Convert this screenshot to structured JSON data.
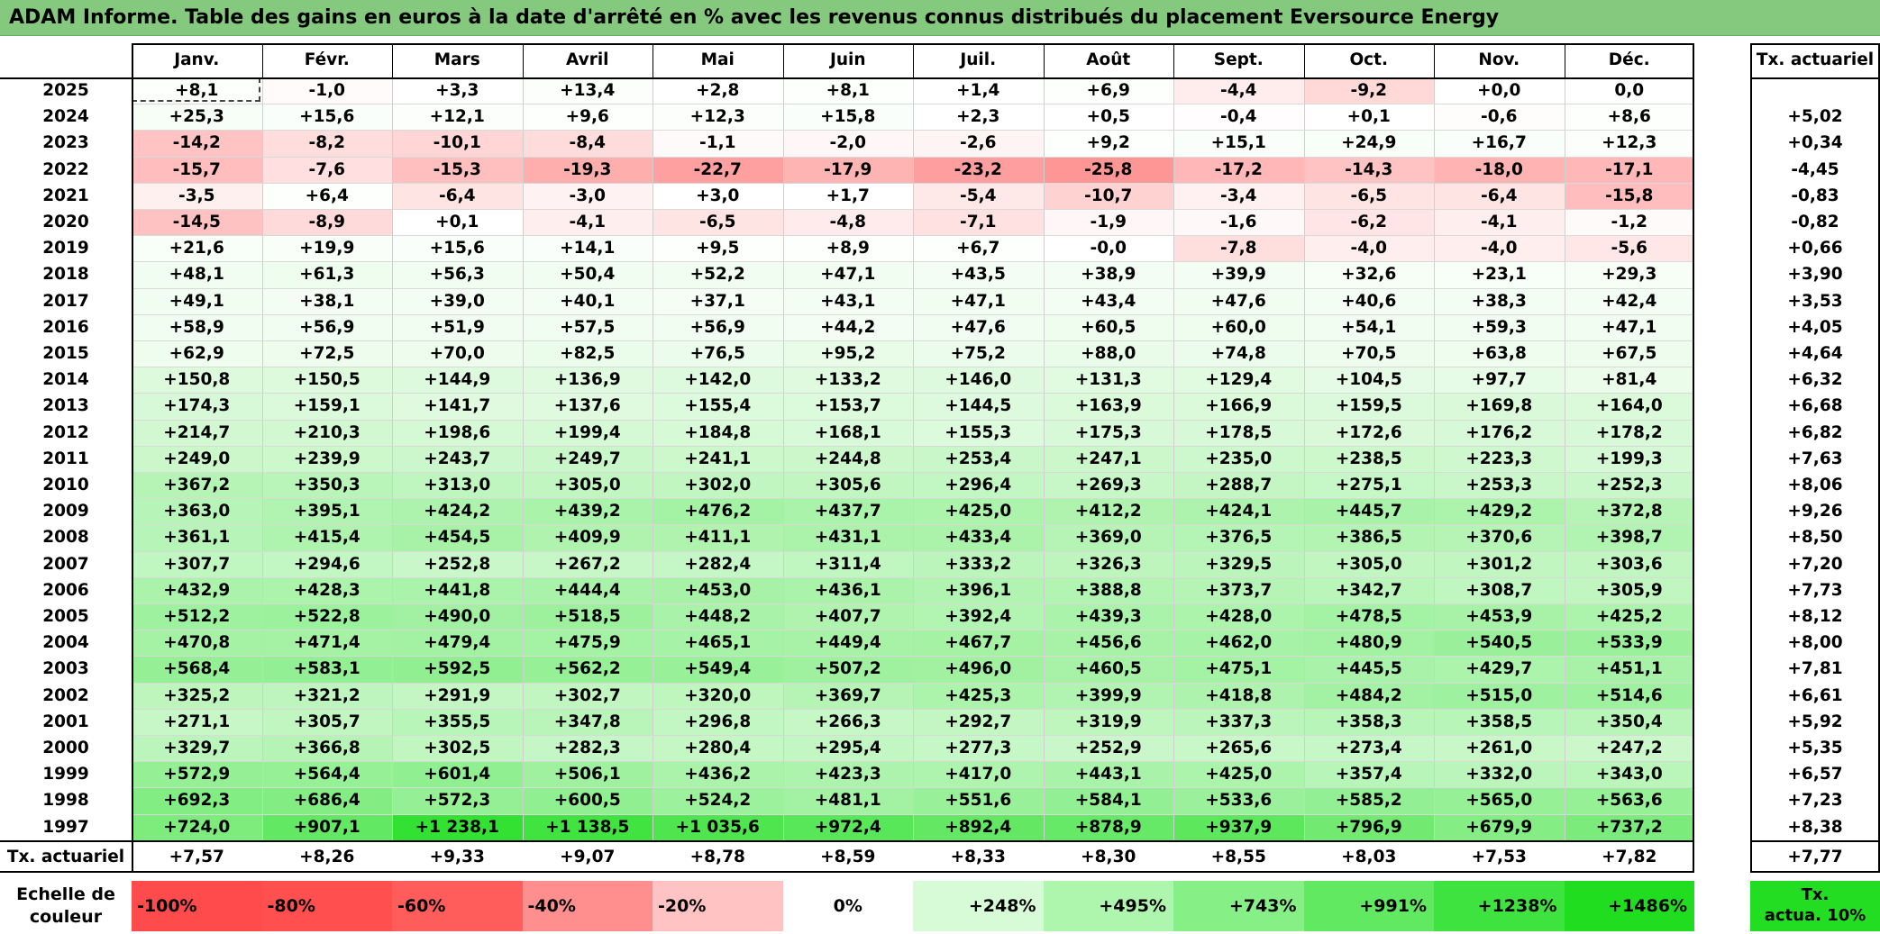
{
  "title": "ADAM Informe. Table des gains en euros à la date d'arrêté en % avec les revenus connus distribués du placement Eversource Energy",
  "chart_data": {
    "type": "table",
    "months": [
      "Janv.",
      "Févr.",
      "Mars",
      "Avril",
      "Mai",
      "Juin",
      "Juil.",
      "Août",
      "Sept.",
      "Oct.",
      "Nov.",
      "Déc."
    ],
    "rate_header": "Tx. actuariel",
    "rows": [
      {
        "year": "2025",
        "values": [
          "+8,1",
          "-1,0",
          "+3,3",
          "+13,4",
          "+2,8",
          "+8,1",
          "+1,4",
          "+6,9",
          "-4,4",
          "-9,2",
          "+0,0",
          "0,0"
        ],
        "rate": ""
      },
      {
        "year": "2024",
        "values": [
          "+25,3",
          "+15,6",
          "+12,1",
          "+9,6",
          "+12,3",
          "+15,8",
          "+2,3",
          "+0,5",
          "-0,4",
          "+0,1",
          "-0,6",
          "+8,6"
        ],
        "rate": "+5,02"
      },
      {
        "year": "2023",
        "values": [
          "-14,2",
          "-8,2",
          "-10,1",
          "-8,4",
          "-1,1",
          "-2,0",
          "-2,6",
          "+9,2",
          "+15,1",
          "+24,9",
          "+16,7",
          "+12,3"
        ],
        "rate": "+0,34"
      },
      {
        "year": "2022",
        "values": [
          "-15,7",
          "-7,6",
          "-15,3",
          "-19,3",
          "-22,7",
          "-17,9",
          "-23,2",
          "-25,8",
          "-17,2",
          "-14,3",
          "-18,0",
          "-17,1"
        ],
        "rate": "-4,45"
      },
      {
        "year": "2021",
        "values": [
          "-3,5",
          "+6,4",
          "-6,4",
          "-3,0",
          "+3,0",
          "+1,7",
          "-5,4",
          "-10,7",
          "-3,4",
          "-6,5",
          "-6,4",
          "-15,8"
        ],
        "rate": "-0,83"
      },
      {
        "year": "2020",
        "values": [
          "-14,5",
          "-8,9",
          "+0,1",
          "-4,1",
          "-6,5",
          "-4,8",
          "-7,1",
          "-1,9",
          "-1,6",
          "-6,2",
          "-4,1",
          "-1,2"
        ],
        "rate": "-0,82"
      },
      {
        "year": "2019",
        "values": [
          "+21,6",
          "+19,9",
          "+15,6",
          "+14,1",
          "+9,5",
          "+8,9",
          "+6,7",
          "-0,0",
          "-7,8",
          "-4,0",
          "-4,0",
          "-5,6"
        ],
        "rate": "+0,66"
      },
      {
        "year": "2018",
        "values": [
          "+48,1",
          "+61,3",
          "+56,3",
          "+50,4",
          "+52,2",
          "+47,1",
          "+43,5",
          "+38,9",
          "+39,9",
          "+32,6",
          "+23,1",
          "+29,3"
        ],
        "rate": "+3,90"
      },
      {
        "year": "2017",
        "values": [
          "+49,1",
          "+38,1",
          "+39,0",
          "+40,1",
          "+37,1",
          "+43,1",
          "+47,1",
          "+43,4",
          "+47,6",
          "+40,6",
          "+38,3",
          "+42,4"
        ],
        "rate": "+3,53"
      },
      {
        "year": "2016",
        "values": [
          "+58,9",
          "+56,9",
          "+51,9",
          "+57,5",
          "+56,9",
          "+44,2",
          "+47,6",
          "+60,5",
          "+60,0",
          "+54,1",
          "+59,3",
          "+47,1"
        ],
        "rate": "+4,05"
      },
      {
        "year": "2015",
        "values": [
          "+62,9",
          "+72,5",
          "+70,0",
          "+82,5",
          "+76,5",
          "+95,2",
          "+75,2",
          "+88,0",
          "+74,8",
          "+70,5",
          "+63,8",
          "+67,5"
        ],
        "rate": "+4,64"
      },
      {
        "year": "2014",
        "values": [
          "+150,8",
          "+150,5",
          "+144,9",
          "+136,9",
          "+142,0",
          "+133,2",
          "+146,0",
          "+131,3",
          "+129,4",
          "+104,5",
          "+97,7",
          "+81,4"
        ],
        "rate": "+6,32"
      },
      {
        "year": "2013",
        "values": [
          "+174,3",
          "+159,1",
          "+141,7",
          "+137,6",
          "+155,4",
          "+153,7",
          "+144,5",
          "+163,9",
          "+166,9",
          "+159,5",
          "+169,8",
          "+164,0"
        ],
        "rate": "+6,68"
      },
      {
        "year": "2012",
        "values": [
          "+214,7",
          "+210,3",
          "+198,6",
          "+199,4",
          "+184,8",
          "+168,1",
          "+155,3",
          "+175,3",
          "+178,5",
          "+172,6",
          "+176,2",
          "+178,2"
        ],
        "rate": "+6,82"
      },
      {
        "year": "2011",
        "values": [
          "+249,0",
          "+239,9",
          "+243,7",
          "+249,7",
          "+241,1",
          "+244,8",
          "+253,4",
          "+247,1",
          "+235,0",
          "+238,5",
          "+223,3",
          "+199,3"
        ],
        "rate": "+7,63"
      },
      {
        "year": "2010",
        "values": [
          "+367,2",
          "+350,3",
          "+313,0",
          "+305,0",
          "+302,0",
          "+305,6",
          "+296,4",
          "+269,3",
          "+288,7",
          "+275,1",
          "+253,3",
          "+252,3"
        ],
        "rate": "+8,06"
      },
      {
        "year": "2009",
        "values": [
          "+363,0",
          "+395,1",
          "+424,2",
          "+439,2",
          "+476,2",
          "+437,7",
          "+425,0",
          "+412,2",
          "+424,1",
          "+445,7",
          "+429,2",
          "+372,8"
        ],
        "rate": "+9,26"
      },
      {
        "year": "2008",
        "values": [
          "+361,1",
          "+415,4",
          "+454,5",
          "+409,9",
          "+411,1",
          "+431,1",
          "+433,4",
          "+369,0",
          "+376,5",
          "+386,5",
          "+370,6",
          "+398,7"
        ],
        "rate": "+8,50"
      },
      {
        "year": "2007",
        "values": [
          "+307,7",
          "+294,6",
          "+252,8",
          "+267,2",
          "+282,4",
          "+311,4",
          "+333,2",
          "+326,3",
          "+329,5",
          "+305,0",
          "+301,2",
          "+303,6"
        ],
        "rate": "+7,20"
      },
      {
        "year": "2006",
        "values": [
          "+432,9",
          "+428,3",
          "+441,8",
          "+444,4",
          "+453,0",
          "+436,1",
          "+396,1",
          "+388,8",
          "+373,7",
          "+342,7",
          "+308,7",
          "+305,9"
        ],
        "rate": "+7,73"
      },
      {
        "year": "2005",
        "values": [
          "+512,2",
          "+522,8",
          "+490,0",
          "+518,5",
          "+448,2",
          "+407,7",
          "+392,4",
          "+439,3",
          "+428,0",
          "+478,5",
          "+453,9",
          "+425,2"
        ],
        "rate": "+8,12"
      },
      {
        "year": "2004",
        "values": [
          "+470,8",
          "+471,4",
          "+479,4",
          "+475,9",
          "+465,1",
          "+449,4",
          "+467,7",
          "+456,6",
          "+462,0",
          "+480,9",
          "+540,5",
          "+533,9"
        ],
        "rate": "+8,00"
      },
      {
        "year": "2003",
        "values": [
          "+568,4",
          "+583,1",
          "+592,5",
          "+562,2",
          "+549,4",
          "+507,2",
          "+496,0",
          "+460,5",
          "+475,1",
          "+445,5",
          "+429,7",
          "+451,1"
        ],
        "rate": "+7,81"
      },
      {
        "year": "2002",
        "values": [
          "+325,2",
          "+321,2",
          "+291,9",
          "+302,7",
          "+320,0",
          "+369,7",
          "+425,3",
          "+399,9",
          "+418,8",
          "+484,2",
          "+515,0",
          "+514,6"
        ],
        "rate": "+6,61"
      },
      {
        "year": "2001",
        "values": [
          "+271,1",
          "+305,7",
          "+355,5",
          "+347,8",
          "+296,8",
          "+266,3",
          "+292,7",
          "+319,9",
          "+337,3",
          "+358,3",
          "+358,5",
          "+350,4"
        ],
        "rate": "+5,92"
      },
      {
        "year": "2000",
        "values": [
          "+329,7",
          "+366,8",
          "+302,5",
          "+282,3",
          "+280,4",
          "+295,4",
          "+277,3",
          "+252,9",
          "+265,6",
          "+273,4",
          "+261,0",
          "+247,2"
        ],
        "rate": "+5,35"
      },
      {
        "year": "1999",
        "values": [
          "+572,9",
          "+564,4",
          "+601,4",
          "+506,1",
          "+436,2",
          "+423,3",
          "+417,0",
          "+443,1",
          "+425,0",
          "+357,4",
          "+332,0",
          "+343,0"
        ],
        "rate": "+6,57"
      },
      {
        "year": "1998",
        "values": [
          "+692,3",
          "+686,4",
          "+572,3",
          "+600,5",
          "+524,2",
          "+481,1",
          "+551,6",
          "+584,1",
          "+533,6",
          "+585,2",
          "+565,0",
          "+563,6"
        ],
        "rate": "+7,23"
      },
      {
        "year": "1997",
        "values": [
          "+724,0",
          "+907,1",
          "+1 238,1",
          "+1 138,5",
          "+1 035,6",
          "+972,4",
          "+892,4",
          "+878,9",
          "+937,9",
          "+796,9",
          "+679,9",
          "+737,2"
        ],
        "rate": "+8,38"
      }
    ],
    "footer": {
      "label": "Tx. actuariel",
      "values": [
        "+7,57",
        "+8,26",
        "+9,33",
        "+9,07",
        "+8,78",
        "+8,59",
        "+8,33",
        "+8,30",
        "+8,55",
        "+8,03",
        "+7,53",
        "+7,82"
      ],
      "rate": "+7,77"
    },
    "legend": {
      "label_line1": "Echelle de",
      "label_line2": "couleur",
      "cells": [
        "-100%",
        "-80%",
        "-60%",
        "-40%",
        "-20%",
        "0%",
        "+248%",
        "+495%",
        "+743%",
        "+991%",
        "+1238%",
        "+1486%"
      ],
      "cell_colors": [
        "#ff4b4b",
        "#ff4f4f",
        "#ff5c5c",
        "#ff8f8f",
        "#ffc3c3",
        "#ffffff",
        "#d6fbd6",
        "#aef5ae",
        "#86ef86",
        "#62e962",
        "#3fe33f",
        "#20dd20"
      ],
      "rate_line1": "Tx.",
      "rate_line2": "actua. 10%",
      "rate_color": "#22dd22"
    }
  }
}
